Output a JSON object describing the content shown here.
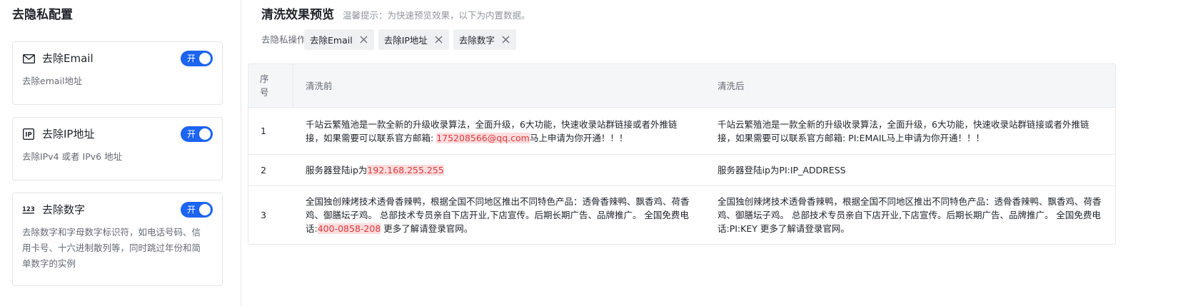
{
  "left": {
    "title": "去隐私配置",
    "cards": [
      {
        "icon": "mail-icon",
        "title": "去除Email",
        "toggle": "开",
        "desc": "去除email地址"
      },
      {
        "icon": "ip-icon",
        "title": "去除IP地址",
        "toggle": "开",
        "desc": "去除IPv4 或者 IPv6 地址"
      },
      {
        "icon": "numbers-icon",
        "title": "去除数字",
        "toggle": "开",
        "desc_lines": [
          "去除数字和字母数字标识符，如电话号码、信",
          "用卡号、十六进制散列等，同时跳过年份和简",
          "单数字的实例"
        ]
      }
    ]
  },
  "right": {
    "title": "清洗效果预览",
    "tip": "温馨提示：为快速预览效果，以下为内置数据。",
    "ops_label": "去隐私操作:",
    "tags": [
      "去除Email",
      "去除IP地址",
      "去除数字"
    ],
    "table": {
      "headers": {
        "idx": "序号",
        "before": "清洗前",
        "after": "清洗后"
      },
      "rows": [
        {
          "idx": "1",
          "before": {
            "pre": "千站云繁殖池是一款全新的升级收录算法，全面升级，6大功能，快速收录站群链接或者外推链接，如果需要可以联系官方邮箱: ",
            "hl": "175208566@qq.com",
            "post": "马上申请为你开通！！！"
          },
          "after": "千站云繁殖池是一款全新的升级收录算法，全面升级，6大功能，快速收录站群链接或者外推链接，如果需要可以联系官方邮箱: PI:EMAIL马上申请为你开通！！！"
        },
        {
          "idx": "2",
          "before": {
            "pre": "服务器登陆ip为",
            "hl": "192.168.255.255",
            "post": ""
          },
          "after": "服务器登陆ip为PI:IP_ADDRESS"
        },
        {
          "idx": "3",
          "before": {
            "pre": "全国独创辣烤技术透骨香辣鸭，根据全国不同地区推出不同特色产品：透骨香辣鸭、飘香鸡、荷香鸡、御膳坛子鸡。 总部技术专员亲自下店开业,下店宣传。后期长期广告、品牌推广。 全国免费电话:",
            "hl": "400-0858-208",
            "post": " 更多了解请登录官网。"
          },
          "after": "全国独创辣烤技术透骨香辣鸭，根据全国不同地区推出不同特色产品：透骨香辣鸭、飘香鸡、荷香鸡、御膳坛子鸡。 总部技术专员亲自下店开业,下店宣传。后期长期广告、品牌推广。 全国免费电话:PI:KEY 更多了解请登录官网。"
        }
      ]
    }
  }
}
